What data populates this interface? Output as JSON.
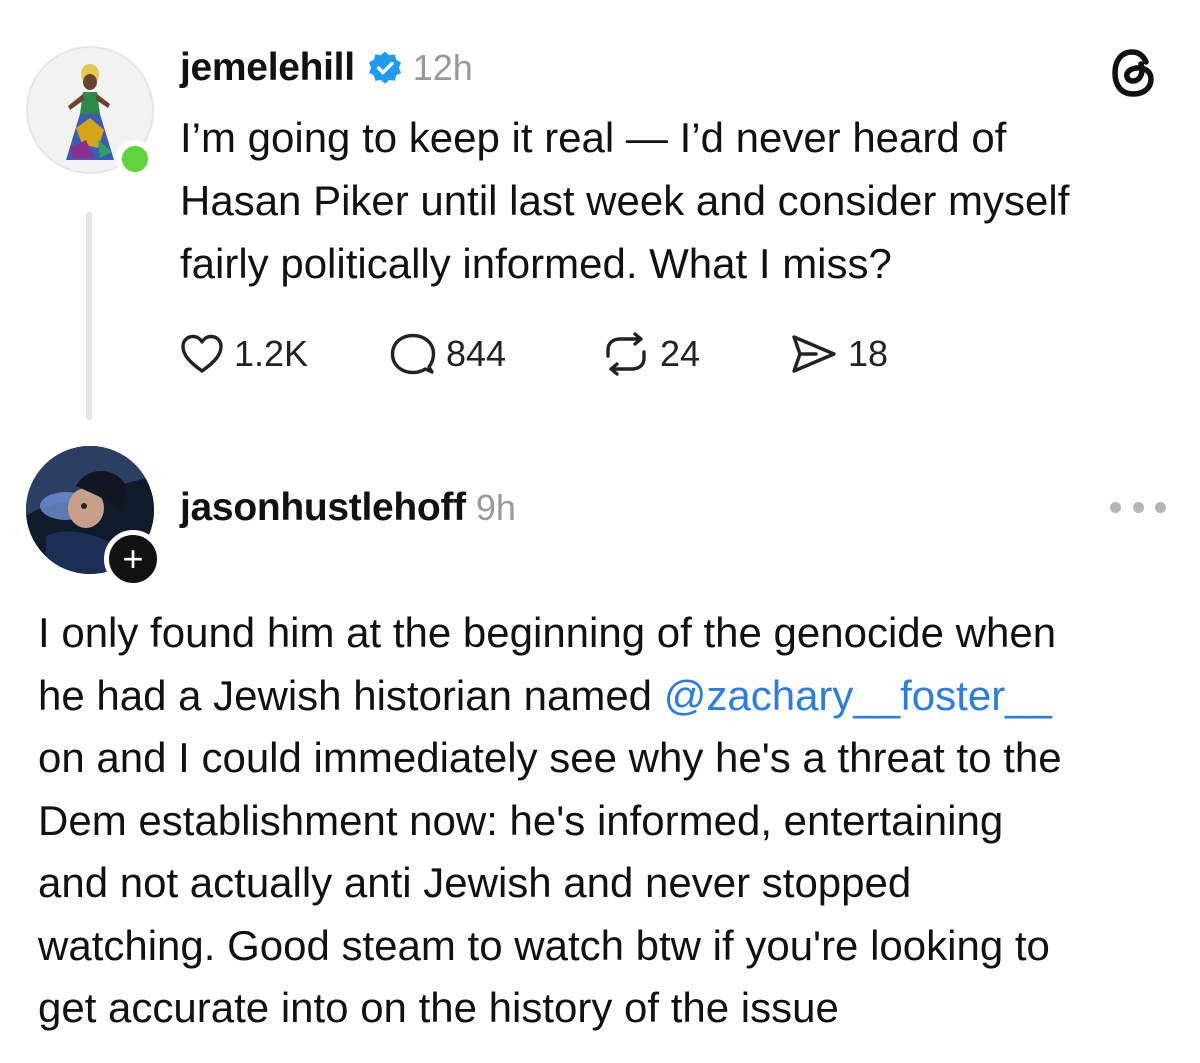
{
  "post1": {
    "username": "jemelehill",
    "time": "12h",
    "verified": true,
    "online": true,
    "avatar": "profile-photo-woman-colorful-dress",
    "lines": [
      "I’m going to keep it real — I’d never heard of",
      "Hasan Piker until last week and consider myself",
      "fairly politically informed. What I miss?"
    ],
    "actions": {
      "likes": "1.2K",
      "replies": "844",
      "reposts": "24",
      "shares": "18"
    },
    "app_icon": "threads-logo-icon"
  },
  "post2": {
    "username": "jasonhustlehoff",
    "time": "9h",
    "avatar": "profile-photo-neon-blue",
    "follow_icon": "plus-icon",
    "more_icon": "more-dots-icon",
    "line1": "I only found him at the beginning of the genocide when",
    "line2_before": "he had a Jewish historian named ",
    "mention": "@zachary__foster__",
    "lines_rest": [
      "on and I could immediately see why he's a threat to the",
      "Dem establishment now: he's informed, entertaining",
      "and not actually anti Jewish and never stopped",
      "watching. Good steam to watch btw if you're looking to",
      "get accurate into on the history of the issue"
    ]
  },
  "colors": {
    "accent_link": "#2b7de0",
    "verified_blue": "#1d9bf0",
    "online_green": "#5ed33c",
    "muted_text": "#999999"
  }
}
